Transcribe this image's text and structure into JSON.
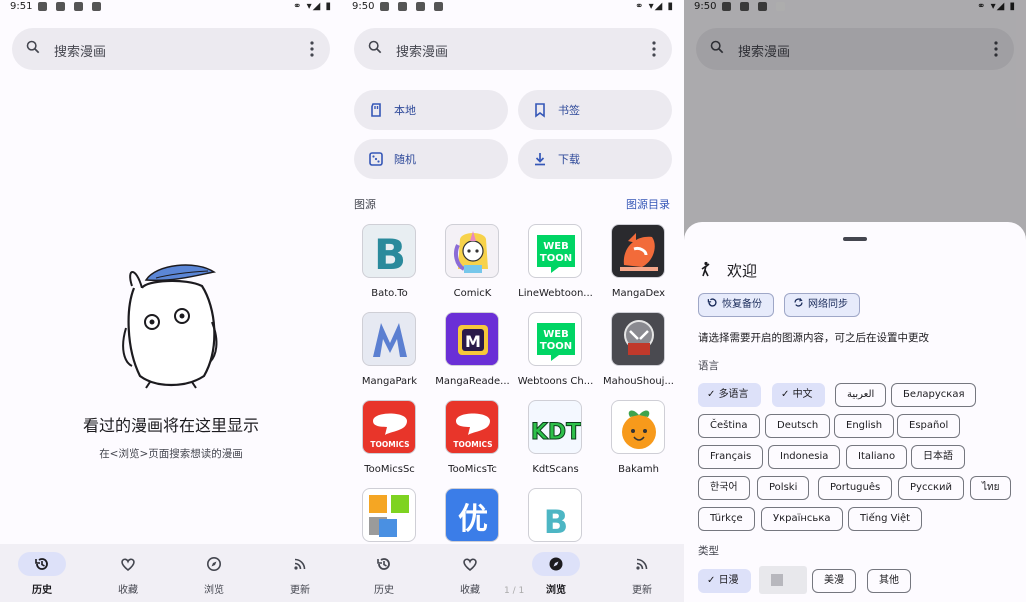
{
  "panel1": {
    "status": {
      "time": "9:51"
    },
    "search": {
      "placeholder": "搜索漫画"
    },
    "empty": {
      "title": "看过的漫画将在这里显示",
      "subtitle": "在<浏览>页面搜索想读的漫画"
    },
    "nav": [
      "历史",
      "收藏",
      "浏览",
      "更新"
    ],
    "active_nav": "历史"
  },
  "panel2": {
    "status": {
      "time": "9:50"
    },
    "search": {
      "placeholder": "搜索漫画"
    },
    "quick": [
      "本地",
      "书签",
      "随机",
      "下载"
    ],
    "section": {
      "label": "图源",
      "link": "图源目录"
    },
    "sources": [
      {
        "name": "Bato.To"
      },
      {
        "name": "ComicK"
      },
      {
        "name": "LineWebtoon..."
      },
      {
        "name": "MangaDex"
      },
      {
        "name": "MangaPark"
      },
      {
        "name": "MangaReade..."
      },
      {
        "name": "Webtoons Ch..."
      },
      {
        "name": "MahouShouj..."
      },
      {
        "name": "TooMicsSc"
      },
      {
        "name": "TooMicsTc"
      },
      {
        "name": "KdtScans"
      },
      {
        "name": "Bakamh"
      }
    ],
    "logo_text": {
      "webtoon": "WEB TOON",
      "toomics": "TOOMICS",
      "kdt": "KDT",
      "you": "优",
      "b": "B",
      "m": "M"
    },
    "page_indicator": "1 / 1",
    "nav": [
      "历史",
      "收藏",
      "浏览",
      "更新"
    ],
    "active_nav": "浏览"
  },
  "panel3": {
    "status": {
      "time": "9:50"
    },
    "search": {
      "placeholder": "搜索漫画"
    },
    "sheet": {
      "title": "欢迎",
      "buttons": [
        "恢复备份",
        "网络同步"
      ],
      "description": "请选择需要开启的图源内容，可之后在设置中更改",
      "language_label": "语言",
      "languages": [
        {
          "label": "多语言",
          "selected": true
        },
        {
          "label": "中文",
          "selected": true
        },
        {
          "label": "العربية",
          "selected": false
        },
        {
          "label": "Беларуская",
          "selected": false
        },
        {
          "label": "Čeština",
          "selected": false
        },
        {
          "label": "Deutsch",
          "selected": false
        },
        {
          "label": "English",
          "selected": false
        },
        {
          "label": "Español",
          "selected": false
        },
        {
          "label": "Français",
          "selected": false
        },
        {
          "label": "Indonesia",
          "selected": false
        },
        {
          "label": "Italiano",
          "selected": false
        },
        {
          "label": "日本語",
          "selected": false
        },
        {
          "label": "한국어",
          "selected": false
        },
        {
          "label": "Polski",
          "selected": false
        },
        {
          "label": "Português",
          "selected": false
        },
        {
          "label": "Русский",
          "selected": false
        },
        {
          "label": "ไทย",
          "selected": false
        },
        {
          "label": "Türkçe",
          "selected": false
        },
        {
          "label": "Українська",
          "selected": false
        },
        {
          "label": "Tiếng Việt",
          "selected": false
        }
      ],
      "type_label": "类型",
      "types": [
        {
          "label": "日漫",
          "selected": true
        },
        {
          "label": "美漫",
          "selected": false
        },
        {
          "label": "其他",
          "selected": false
        }
      ]
    }
  },
  "colors": {
    "accent": "#3557b7",
    "nav_active": "#dde1f9",
    "surface": "#eceaf0"
  }
}
